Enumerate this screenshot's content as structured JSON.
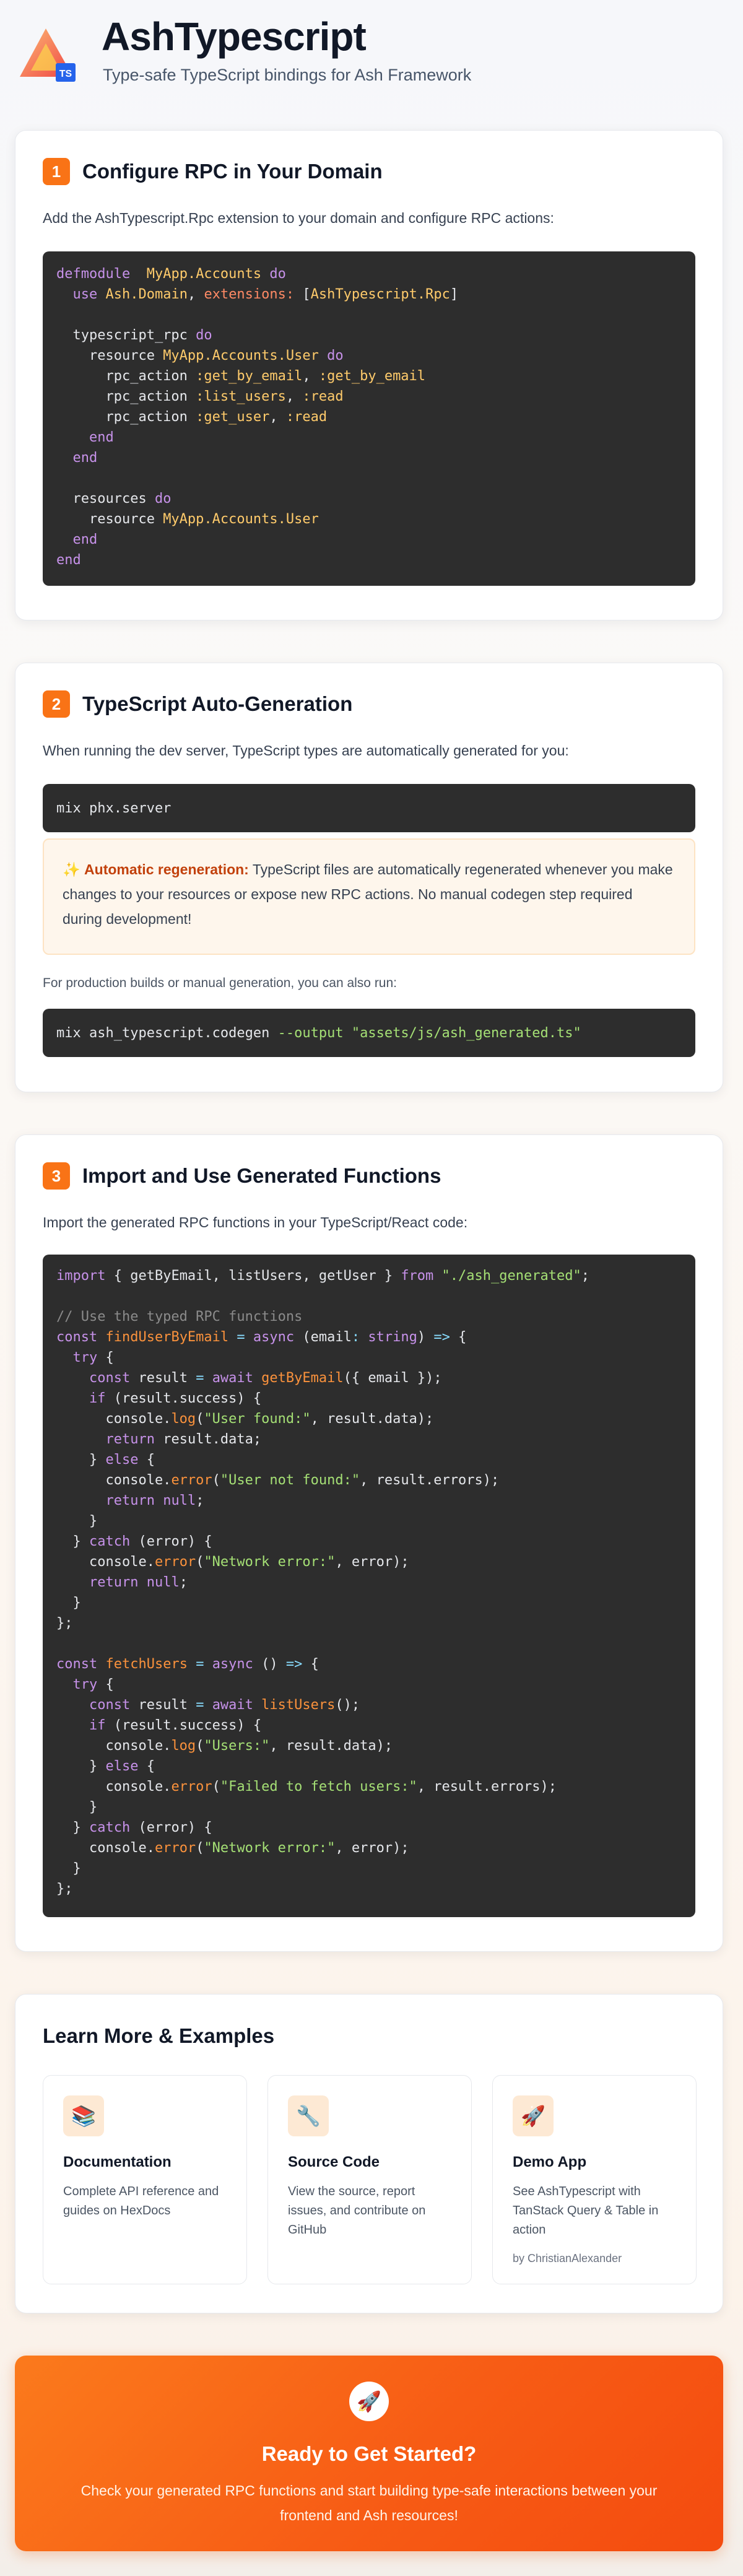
{
  "header": {
    "title": "AshTypescript",
    "subtitle": "Type-safe TypeScript bindings for Ash Framework",
    "logo_badge": "TS"
  },
  "step1": {
    "number": "1",
    "title": "Configure RPC in Your Domain",
    "description": "Add the AshTypescript.Rpc extension to your domain and configure RPC actions:",
    "code_lines": [
      [
        [
          "kw",
          "defmodule"
        ],
        [
          "",
          "  "
        ],
        [
          "mod",
          "MyApp.Accounts"
        ],
        [
          "",
          " "
        ],
        [
          "kw",
          "do"
        ]
      ],
      [
        [
          "",
          "  "
        ],
        [
          "kw",
          "use"
        ],
        [
          "",
          " "
        ],
        [
          "mod",
          "Ash.Domain"
        ],
        [
          "",
          ", "
        ],
        [
          "key",
          "extensions:"
        ],
        [
          "",
          " ["
        ],
        [
          "mod",
          "AshTypescript.Rpc"
        ],
        [
          "",
          "]"
        ]
      ],
      [],
      [
        [
          "",
          "  typescript_rpc "
        ],
        [
          "kw",
          "do"
        ]
      ],
      [
        [
          "",
          "    resource "
        ],
        [
          "mod",
          "MyApp.Accounts.User"
        ],
        [
          "",
          " "
        ],
        [
          "kw",
          "do"
        ]
      ],
      [
        [
          "",
          "      rpc_action "
        ],
        [
          "atm",
          ":get_by_email"
        ],
        [
          "",
          ", "
        ],
        [
          "atm",
          ":get_by_email"
        ]
      ],
      [
        [
          "",
          "      rpc_action "
        ],
        [
          "atm",
          ":list_users"
        ],
        [
          "",
          ", "
        ],
        [
          "atm",
          ":read"
        ]
      ],
      [
        [
          "",
          "      rpc_action "
        ],
        [
          "atm",
          ":get_user"
        ],
        [
          "",
          ", "
        ],
        [
          "atm",
          ":read"
        ]
      ],
      [
        [
          "",
          "    "
        ],
        [
          "kw",
          "end"
        ]
      ],
      [
        [
          "",
          "  "
        ],
        [
          "kw",
          "end"
        ]
      ],
      [],
      [
        [
          "",
          "  resources "
        ],
        [
          "kw",
          "do"
        ]
      ],
      [
        [
          "",
          "    resource "
        ],
        [
          "mod",
          "MyApp.Accounts.User"
        ]
      ],
      [
        [
          "",
          "  "
        ],
        [
          "kw",
          "end"
        ]
      ],
      [
        [
          "kw",
          "end"
        ]
      ]
    ]
  },
  "step2": {
    "number": "2",
    "title": "TypeScript Auto-Generation",
    "description": "When running the dev server, TypeScript types are automatically generated for you:",
    "dev_command": "mix phx.server",
    "notice_emoji": "✨",
    "notice_strong": "Automatic regeneration:",
    "notice_text": " TypeScript files are automatically regenerated whenever you make changes to your resources or expose new RPC actions. No manual codegen step required during development!",
    "production_note": "For production builds or manual generation, you can also run:",
    "codegen_cmd": "mix ash_typescript.codegen ",
    "codegen_flag": "--output",
    "codegen_path": "\"assets/js/ash_generated.ts\""
  },
  "step3": {
    "number": "3",
    "title": "Import and Use Generated Functions",
    "description": "Import the generated RPC functions in your TypeScript/React code:",
    "code_lines": [
      [
        [
          "kw",
          "import"
        ],
        [
          "",
          " { getByEmail, listUsers, getUser } "
        ],
        [
          "kw",
          "from"
        ],
        [
          "",
          " "
        ],
        [
          "str",
          "\"./ash_generated\""
        ],
        [
          "",
          ";"
        ]
      ],
      [],
      [
        [
          "cmt",
          "// Use the typed RPC functions"
        ]
      ],
      [
        [
          "kw",
          "const"
        ],
        [
          "",
          " "
        ],
        [
          "fn",
          "findUserByEmail"
        ],
        [
          "",
          " "
        ],
        [
          "arr",
          "="
        ],
        [
          "",
          " "
        ],
        [
          "kw",
          "async"
        ],
        [
          "",
          " (email"
        ],
        [
          "arr",
          ":"
        ],
        [
          "",
          " "
        ],
        [
          "kw",
          "string"
        ],
        [
          "",
          ") "
        ],
        [
          "arr",
          "=>"
        ],
        [
          "",
          " {"
        ]
      ],
      [
        [
          "",
          "  "
        ],
        [
          "kw",
          "try"
        ],
        [
          "",
          " {"
        ]
      ],
      [
        [
          "",
          "    "
        ],
        [
          "kw",
          "const"
        ],
        [
          "",
          " result "
        ],
        [
          "arr",
          "="
        ],
        [
          "",
          " "
        ],
        [
          "kw",
          "await"
        ],
        [
          "",
          " "
        ],
        [
          "fn",
          "getByEmail"
        ],
        [
          "",
          "({ email });"
        ]
      ],
      [
        [
          "",
          "    "
        ],
        [
          "kw",
          "if"
        ],
        [
          "",
          " (result.success) {"
        ]
      ],
      [
        [
          "",
          "      console."
        ],
        [
          "fn",
          "log"
        ],
        [
          "",
          "("
        ],
        [
          "str",
          "\"User found:\""
        ],
        [
          "",
          ", result.data);"
        ]
      ],
      [
        [
          "",
          "      "
        ],
        [
          "kw",
          "return"
        ],
        [
          "",
          " result.data;"
        ]
      ],
      [
        [
          "",
          "    } "
        ],
        [
          "kw",
          "else"
        ],
        [
          "",
          " {"
        ]
      ],
      [
        [
          "",
          "      console."
        ],
        [
          "fn",
          "error"
        ],
        [
          "",
          "("
        ],
        [
          "str",
          "\"User not found:\""
        ],
        [
          "",
          ", result.errors);"
        ]
      ],
      [
        [
          "",
          "      "
        ],
        [
          "kw",
          "return"
        ],
        [
          "",
          " "
        ],
        [
          "kw",
          "null"
        ],
        [
          "",
          ";"
        ]
      ],
      [
        [
          "",
          "    }"
        ]
      ],
      [
        [
          "",
          "  } "
        ],
        [
          "kw",
          "catch"
        ],
        [
          "",
          " (error) {"
        ]
      ],
      [
        [
          "",
          "    console."
        ],
        [
          "fn",
          "error"
        ],
        [
          "",
          "("
        ],
        [
          "str",
          "\"Network error:\""
        ],
        [
          "",
          ", error);"
        ]
      ],
      [
        [
          "",
          "    "
        ],
        [
          "kw",
          "return"
        ],
        [
          "",
          " "
        ],
        [
          "kw",
          "null"
        ],
        [
          "",
          ";"
        ]
      ],
      [
        [
          "",
          "  }"
        ]
      ],
      [
        [
          "",
          "};"
        ]
      ],
      [],
      [
        [
          "kw",
          "const"
        ],
        [
          "",
          " "
        ],
        [
          "fn",
          "fetchUsers"
        ],
        [
          "",
          " "
        ],
        [
          "arr",
          "="
        ],
        [
          "",
          " "
        ],
        [
          "kw",
          "async"
        ],
        [
          "",
          " () "
        ],
        [
          "arr",
          "=>"
        ],
        [
          "",
          " {"
        ]
      ],
      [
        [
          "",
          "  "
        ],
        [
          "kw",
          "try"
        ],
        [
          "",
          " {"
        ]
      ],
      [
        [
          "",
          "    "
        ],
        [
          "kw",
          "const"
        ],
        [
          "",
          " result "
        ],
        [
          "arr",
          "="
        ],
        [
          "",
          " "
        ],
        [
          "kw",
          "await"
        ],
        [
          "",
          " "
        ],
        [
          "fn",
          "listUsers"
        ],
        [
          "",
          "();"
        ]
      ],
      [
        [
          "",
          "    "
        ],
        [
          "kw",
          "if"
        ],
        [
          "",
          " (result.success) {"
        ]
      ],
      [
        [
          "",
          "      console."
        ],
        [
          "fn",
          "log"
        ],
        [
          "",
          "("
        ],
        [
          "str",
          "\"Users:\""
        ],
        [
          "",
          ", result.data);"
        ]
      ],
      [
        [
          "",
          "    } "
        ],
        [
          "kw",
          "else"
        ],
        [
          "",
          " {"
        ]
      ],
      [
        [
          "",
          "      console."
        ],
        [
          "fn",
          "error"
        ],
        [
          "",
          "("
        ],
        [
          "str",
          "\"Failed to fetch users:\""
        ],
        [
          "",
          ", result.errors);"
        ]
      ],
      [
        [
          "",
          "    }"
        ]
      ],
      [
        [
          "",
          "  } "
        ],
        [
          "kw",
          "catch"
        ],
        [
          "",
          " (error) {"
        ]
      ],
      [
        [
          "",
          "    console."
        ],
        [
          "fn",
          "error"
        ],
        [
          "",
          "("
        ],
        [
          "str",
          "\"Network error:\""
        ],
        [
          "",
          ", error);"
        ]
      ],
      [
        [
          "",
          "  }"
        ]
      ],
      [
        [
          "",
          "};"
        ]
      ]
    ]
  },
  "learn": {
    "title": "Learn More & Examples",
    "cards": [
      {
        "icon": "📚",
        "title": "Documentation",
        "description": "Complete API reference and guides on HexDocs"
      },
      {
        "icon": "🔧",
        "title": "Source Code",
        "description": "View the source, report issues, and contribute on GitHub"
      },
      {
        "icon": "🚀",
        "title": "Demo App",
        "description": "See AshTypescript with TanStack Query & Table in action",
        "byline": "by ChristianAlexander"
      }
    ]
  },
  "cta": {
    "icon": "🚀",
    "title": "Ready to Get Started?",
    "text": "Check your generated RPC functions and start building type-safe interactions between your frontend and Ash resources!"
  },
  "colors": {
    "accent": "#f97316",
    "code_bg": "#2d2d2d",
    "notice_bg": "#fef6ec"
  }
}
